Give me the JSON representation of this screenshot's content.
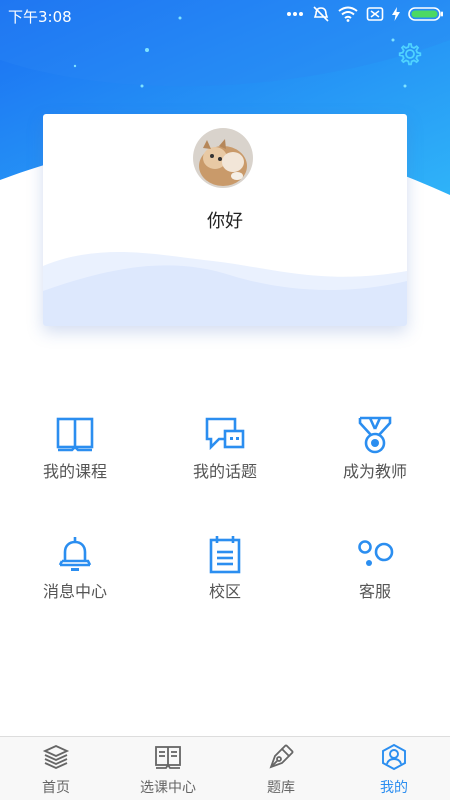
{
  "status_bar": {
    "time": "下午3:08"
  },
  "profile": {
    "greeting": "你好"
  },
  "menu": {
    "items": [
      {
        "label": "我的课程",
        "icon": "book-icon"
      },
      {
        "label": "我的话题",
        "icon": "chat-icon"
      },
      {
        "label": "成为教师",
        "icon": "medal-icon"
      },
      {
        "label": "消息中心",
        "icon": "bell-icon"
      },
      {
        "label": "校区",
        "icon": "notepad-icon"
      },
      {
        "label": "客服",
        "icon": "bubbles-icon"
      }
    ]
  },
  "tabbar": {
    "tabs": [
      {
        "label": "首页",
        "icon": "layers-icon"
      },
      {
        "label": "选课中心",
        "icon": "open-book-icon"
      },
      {
        "label": "题库",
        "icon": "pen-icon"
      },
      {
        "label": "我的",
        "icon": "person-icon",
        "active": true
      }
    ]
  },
  "colors": {
    "accent": "#2b8ef0",
    "header_top": "#1a6ef2",
    "header_bottom": "#2fb3f8"
  }
}
